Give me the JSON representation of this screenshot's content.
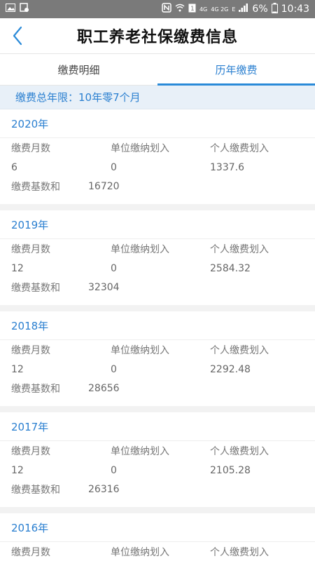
{
  "statusbar": {
    "network_label": "4G",
    "network2_label": "4G 2G",
    "e_label": "E",
    "battery": "6%",
    "time": "10:43"
  },
  "header": {
    "title": "职工养老社保缴费信息"
  },
  "tabs": [
    {
      "label": "缴费明细",
      "active": false
    },
    {
      "label": "历年缴费",
      "active": true
    }
  ],
  "summary": "缴费总年限：10年零7个月",
  "columns": {
    "months": "缴费月数",
    "unit": "单位缴纳划入",
    "personal": "个人缴费划入",
    "base": "缴费基数和"
  },
  "records": [
    {
      "year": "2020年",
      "months": "6",
      "unit": "0",
      "personal": "1337.6",
      "base": "16720"
    },
    {
      "year": "2019年",
      "months": "12",
      "unit": "0",
      "personal": "2584.32",
      "base": "32304"
    },
    {
      "year": "2018年",
      "months": "12",
      "unit": "0",
      "personal": "2292.48",
      "base": "28656"
    },
    {
      "year": "2017年",
      "months": "12",
      "unit": "0",
      "personal": "2105.28",
      "base": "26316"
    },
    {
      "year": "2016年"
    }
  ],
  "colors": {
    "accent": "#2a7fd0",
    "statusbar": "#7a7a7a",
    "summary_bg": "#e8f0f8"
  }
}
